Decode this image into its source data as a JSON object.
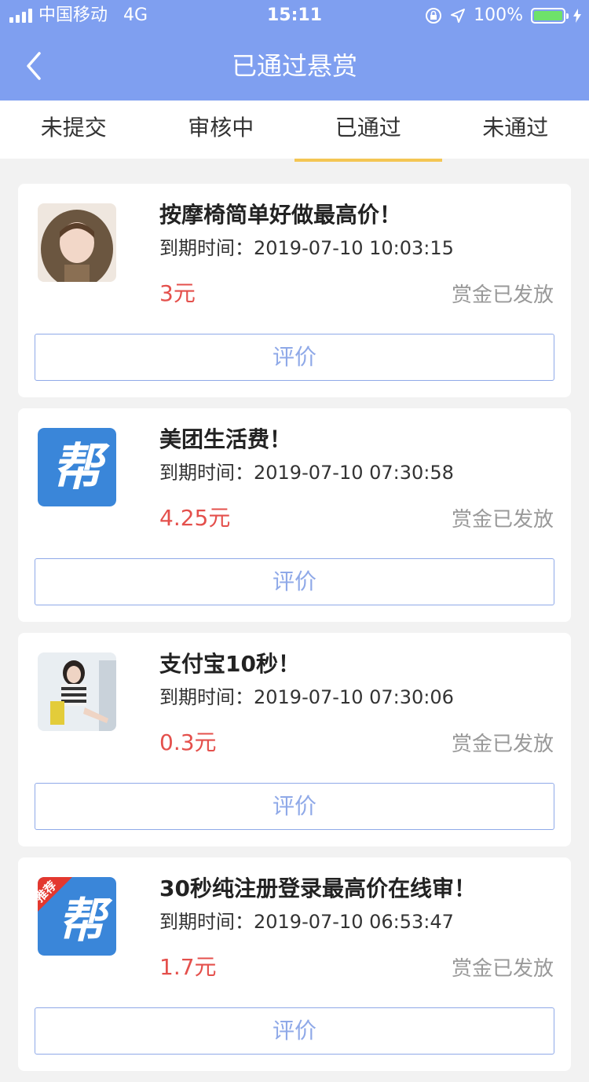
{
  "status_bar": {
    "carrier": "中国移动",
    "network": "4G",
    "time": "15:11",
    "battery_percent": "100%",
    "battery_color": "#6ee26a"
  },
  "header": {
    "title": "已通过悬赏",
    "background": "#7f9ff0"
  },
  "tabs": [
    {
      "label": "未提交",
      "active": false
    },
    {
      "label": "审核中",
      "active": false
    },
    {
      "label": "已通过",
      "active": true
    },
    {
      "label": "未通过",
      "active": false
    }
  ],
  "tab_indicator_color": "#f4c654",
  "tasks": [
    {
      "title": "按摩椅简单好做最高价！",
      "expire_label": "到期时间：",
      "expire_time": "2019-07-10 10:03:15",
      "price": "3元",
      "status": "赏金已发放",
      "button": "评价",
      "thumb": "photo-girl-hood"
    },
    {
      "title": "美团生活费！",
      "expire_label": "到期时间：",
      "expire_time": "2019-07-10 07:30:58",
      "price": "4.25元",
      "status": "赏金已发放",
      "button": "评价",
      "thumb": "bang-logo",
      "thumb_char": "帮"
    },
    {
      "title": "支付宝10秒！",
      "expire_label": "到期时间：",
      "expire_time": "2019-07-10 07:30:06",
      "price": "0.3元",
      "status": "赏金已发放",
      "button": "评价",
      "thumb": "photo-girl-street"
    },
    {
      "title": "30秒纯注册登录最高价在线审！",
      "expire_label": "到期时间：",
      "expire_time": "2019-07-10 06:53:47",
      "price": "1.7元",
      "status": "赏金已发放",
      "button": "评价",
      "thumb": "bang-logo-recommend",
      "thumb_char": "帮",
      "thumb_badge": "推荐"
    }
  ],
  "colors": {
    "price": "#e4504c",
    "button": "#8fa9e8",
    "logo_blue": "#3a86d9"
  }
}
